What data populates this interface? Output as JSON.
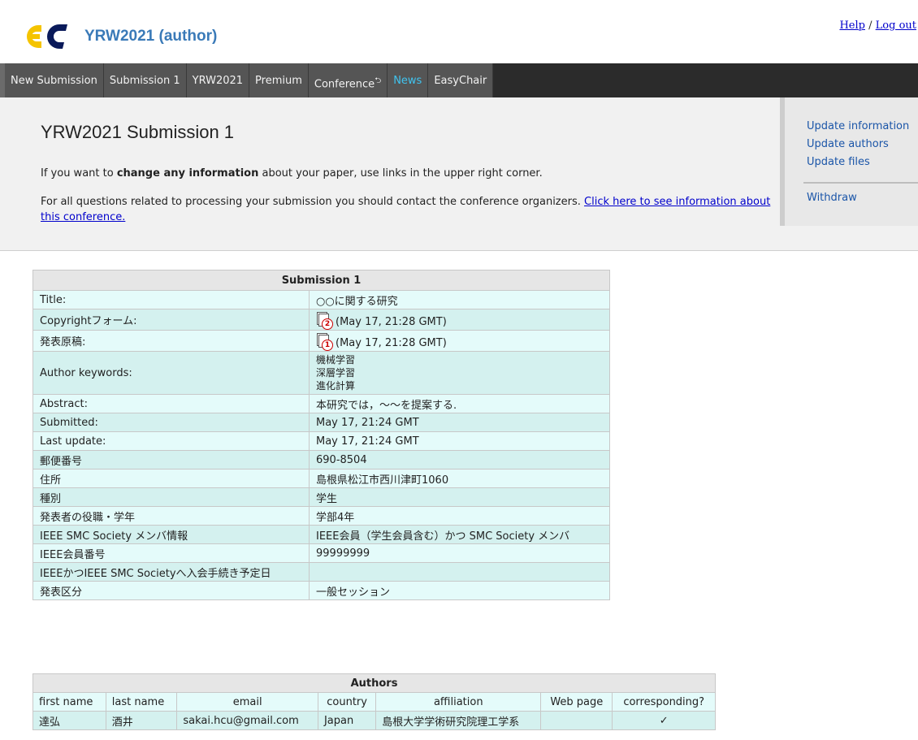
{
  "header": {
    "app_title": "YRW2021 (author)",
    "help_label": "Help",
    "separator": "/",
    "logout_label": "Log out",
    "brand_colors": {
      "yellow": "#f5c400",
      "blue": "#0a1a5a",
      "title": "#3a7ab8"
    }
  },
  "nav": {
    "tabs": [
      {
        "label": "New Submission"
      },
      {
        "label": "Submission 1"
      },
      {
        "label": "YRW2021"
      },
      {
        "label": "Premium"
      },
      {
        "label": "Conference",
        "marker": "⮌"
      },
      {
        "label": "News"
      },
      {
        "label": "EasyChair"
      }
    ]
  },
  "panel": {
    "heading": "YRW2021 Submission 1",
    "p1_pre": "If you want to ",
    "p1_bold": "change any information",
    "p1_post": " about your paper, use links in the upper right corner.",
    "p2_pre": "For all questions related to processing your submission you should contact the conference organizers. ",
    "p2_link": "Click here to see information about this conference."
  },
  "sidemenu": {
    "update_information": "Update information",
    "update_authors": "Update authors",
    "update_files": "Update files",
    "withdraw": "Withdraw"
  },
  "submission": {
    "caption": "Submission 1",
    "title_label": "Title:",
    "title_value": "○○に関する研究",
    "copyright_label": "Copyrightフォーム:",
    "copyright_num": "2",
    "copyright_value": "(May 17, 21:28 GMT)",
    "paper_label": "発表原稿:",
    "paper_num": "1",
    "paper_value": "(May 17, 21:28 GMT)",
    "keywords_label": "Author keywords:",
    "keywords": [
      "機械学習",
      "深層学習",
      "進化計算"
    ],
    "abstract_label": "Abstract:",
    "abstract_value": "本研究では，〜〜を提案する.",
    "submitted_label": "Submitted:",
    "submitted_value": "May 17, 21:24 GMT",
    "last_update_label": "Last update:",
    "last_update_value": "May 17, 21:24 GMT",
    "postal_label": "郵便番号",
    "postal_value": "690-8504",
    "address_label": "住所",
    "address_value": "島根県松江市西川津町1060",
    "type_label": "種別",
    "type_value": "学生",
    "position_label": "発表者の役職・学年",
    "position_value": "学部4年",
    "smc_label": "IEEE SMC Society メンバ情報",
    "smc_value": "IEEE会員（学生会員含む）かつ SMC Society メンバ",
    "ieee_no_label": "IEEE会員番号",
    "ieee_no_value": "99999999",
    "join_label": "IEEEかつIEEE SMC Societyへ入会手続き予定日",
    "join_value": "",
    "session_label": "発表区分",
    "session_value": "一般セッション"
  },
  "authors": {
    "caption": "Authors",
    "columns": [
      "first name",
      "last name",
      "email",
      "country",
      "affiliation",
      "Web page",
      "corresponding?"
    ],
    "rows": [
      {
        "first_name": "達弘",
        "last_name": "酒井",
        "email": "sakai.hcu@gmail.com",
        "country": "Japan",
        "affiliation": "島根大学学術研究院理工学系",
        "web_page": "",
        "corresponding": "✓"
      }
    ]
  }
}
